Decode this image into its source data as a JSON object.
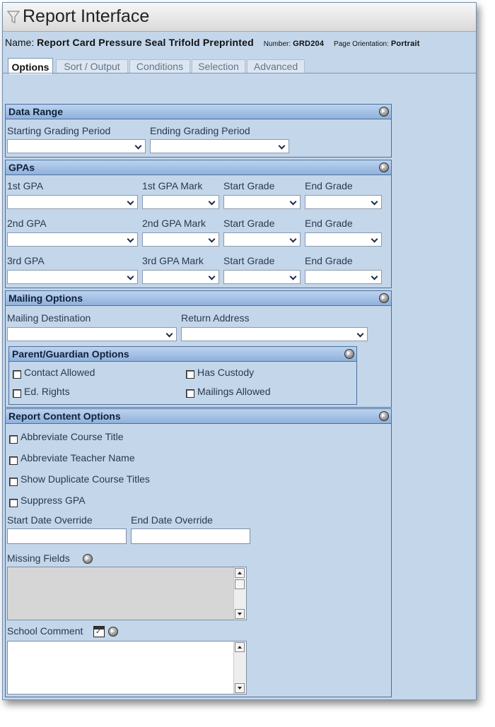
{
  "window": {
    "title": "Report Interface"
  },
  "report": {
    "name_label": "Name:",
    "name": "Report Card Pressure Seal Trifold Preprinted",
    "number_label": "Number:",
    "number": "GRD204",
    "orientation_label": "Page Orientation:",
    "orientation": "Portrait"
  },
  "tabs": [
    "Options",
    "Sort / Output",
    "Conditions",
    "Selection",
    "Advanced"
  ],
  "data_range": {
    "title": "Data Range",
    "starting_label": "Starting Grading Period",
    "ending_label": "Ending Grading Period"
  },
  "gpas": {
    "title": "GPAs",
    "rows": [
      {
        "gpa": "1st GPA",
        "mark": "1st GPA Mark",
        "start": "Start Grade",
        "end": "End Grade"
      },
      {
        "gpa": "2nd GPA",
        "mark": "2nd GPA Mark",
        "start": "Start Grade",
        "end": "End Grade"
      },
      {
        "gpa": "3rd GPA",
        "mark": "3rd GPA Mark",
        "start": "Start Grade",
        "end": "End Grade"
      }
    ]
  },
  "mailing": {
    "title": "Mailing Options",
    "destination_label": "Mailing Destination",
    "return_label": "Return Address",
    "parent": {
      "title": "Parent/Guardian Options",
      "contact_allowed": "Contact Allowed",
      "has_custody": "Has Custody",
      "ed_rights": "Ed. Rights",
      "mailings_allowed": "Mailings Allowed"
    }
  },
  "content": {
    "title": "Report Content Options",
    "abbr_course": "Abbreviate Course Title",
    "abbr_teacher": "Abbreviate Teacher Name",
    "show_dup": "Show Duplicate Course Titles",
    "suppress_gpa": "Suppress GPA",
    "start_override": "Start Date Override",
    "end_override": "End Date Override",
    "missing_fields": "Missing Fields",
    "school_comment": "School Comment"
  }
}
